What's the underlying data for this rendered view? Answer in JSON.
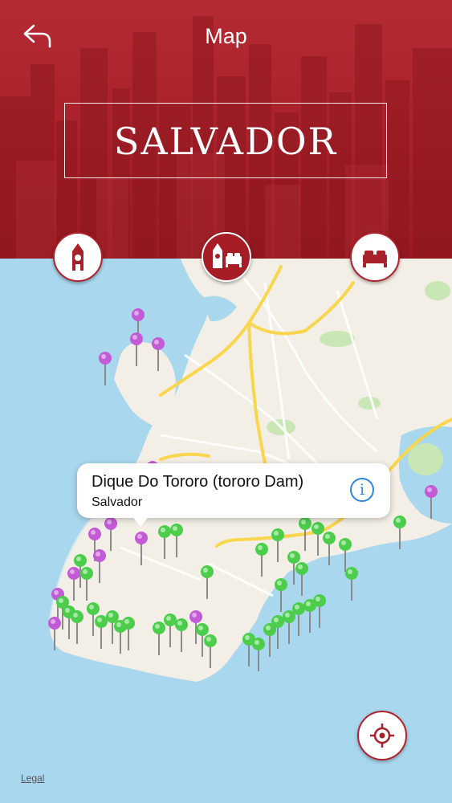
{
  "header": {
    "title": "Map",
    "city": "SALVADOR",
    "back_icon": "back-arrow-icon"
  },
  "categories": [
    {
      "name": "attractions",
      "icon": "clock-tower-icon",
      "selected": false
    },
    {
      "name": "attractions-and-hotels",
      "icon": "tower-and-bed-icon",
      "selected": true
    },
    {
      "name": "hotels",
      "icon": "bed-icon",
      "selected": false
    }
  ],
  "callout": {
    "title": "Dique Do Tororo (tororo Dam)",
    "subtitle": "Salvador",
    "info_icon": "info-icon"
  },
  "map": {
    "pin_colors": {
      "attraction": "#c35ad6",
      "hotel": "#4ccd4c"
    },
    "legal": "Legal",
    "locate_icon": "crosshair-icon"
  },
  "colors": {
    "brand": "#a82029",
    "water": "#a9d7ee",
    "land": "#f3efe6",
    "road_major": "#f8d64e"
  }
}
